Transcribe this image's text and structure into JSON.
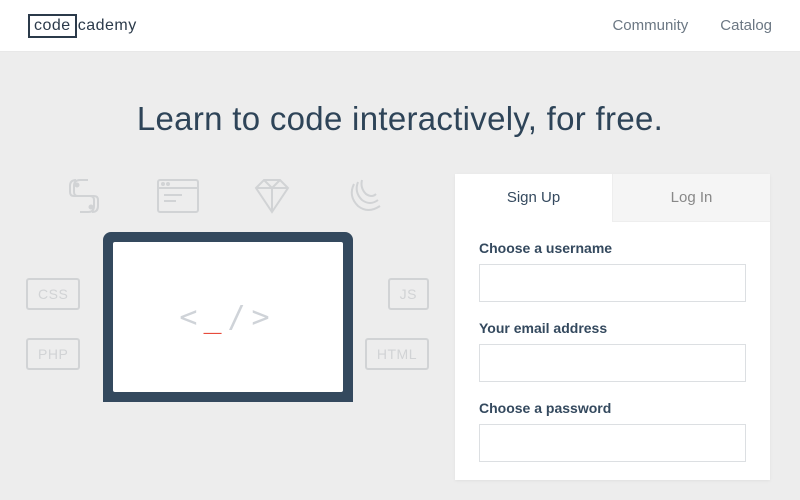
{
  "header": {
    "logo_boxed": "code",
    "logo_rest": "cademy",
    "nav": {
      "community": "Community",
      "catalog": "Catalog"
    }
  },
  "hero": {
    "headline": "Learn to code interactively, for free."
  },
  "illustration": {
    "badges": {
      "css": "CSS",
      "js": "JS",
      "php": "PHP",
      "html": "HTML"
    },
    "screen_left": "<",
    "screen_cursor": "_",
    "screen_right": "/>"
  },
  "signup": {
    "tabs": {
      "signup": "Sign Up",
      "login": "Log In"
    },
    "fields": {
      "username_label": "Choose a username",
      "email_label": "Your email address",
      "password_label": "Choose a password"
    }
  }
}
